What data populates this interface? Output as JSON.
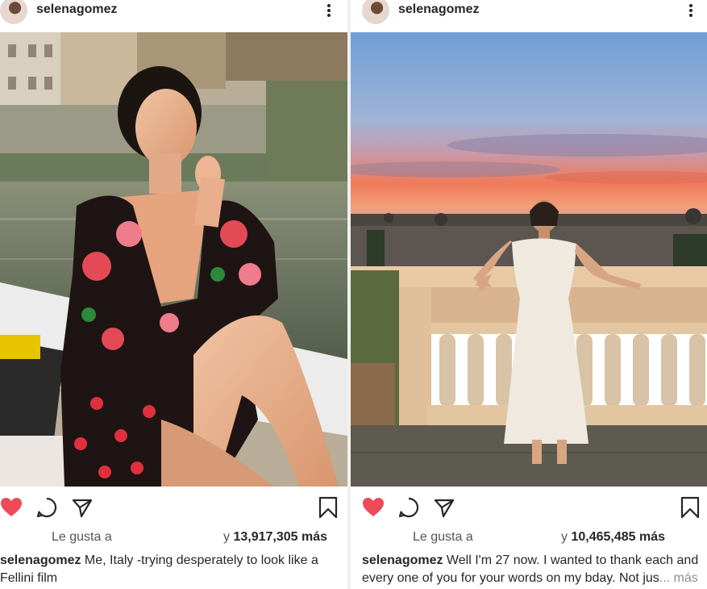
{
  "posts": [
    {
      "username": "selenagomez",
      "likes_prefix": "Le gusta a",
      "likes_connector": "y",
      "likes_count": "13,917,305 más",
      "caption_user": "selenagomez",
      "caption_text": " Me, Italy -trying desperately to look like a Fellini film",
      "more_label": ""
    },
    {
      "username": "selenagomez",
      "likes_prefix": "Le gusta a",
      "likes_connector": "y",
      "likes_count": "10,465,485 más",
      "caption_user": "selenagomez",
      "caption_text": " Well I'm 27 now. I wanted to thank each and every one of you for your words on my bday. Not jus",
      "more_label": "... más"
    }
  ],
  "icons": {
    "like": "heart-icon",
    "comment": "comment-icon",
    "share": "send-icon",
    "save": "bookmark-icon",
    "options": "more-options-icon"
  },
  "colors": {
    "like_red": "#ed4956",
    "text": "#262626",
    "secondary": "#8e8e8e"
  }
}
